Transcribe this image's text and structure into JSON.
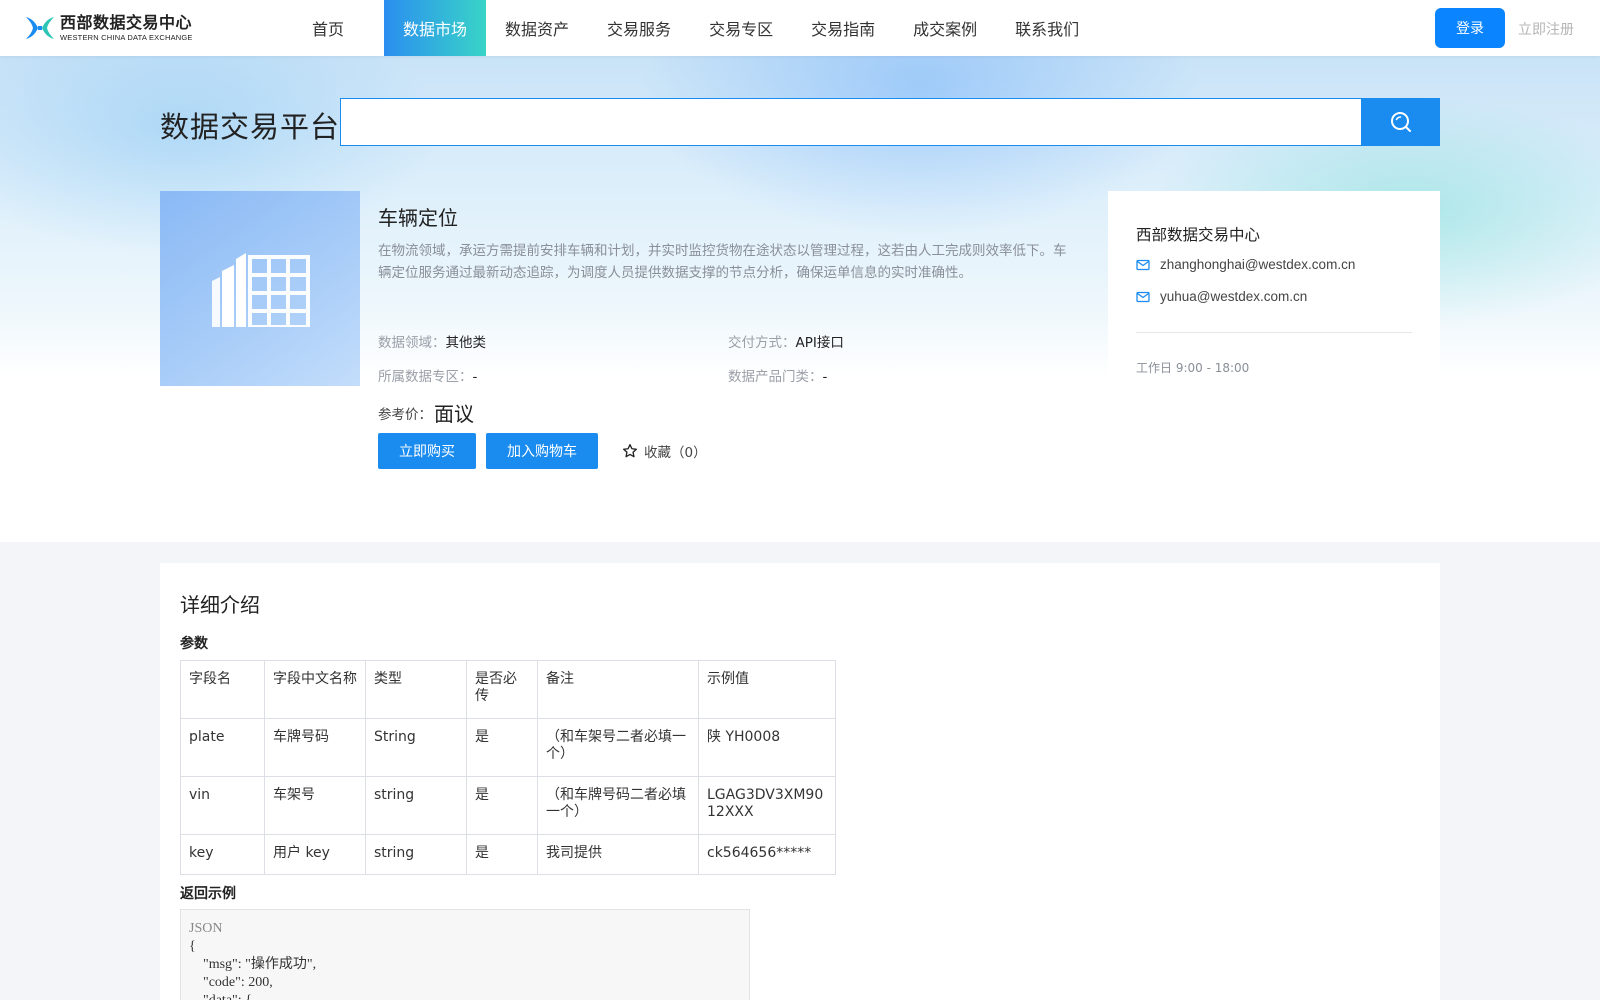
{
  "header": {
    "logo_cn": "西部数据交易中心",
    "logo_en": "WESTERN CHINA DATA EXCHANGE",
    "nav": [
      {
        "label": "首页",
        "active": false
      },
      {
        "label": "数据市场",
        "active": true
      },
      {
        "label": "数据资产",
        "active": false
      },
      {
        "label": "交易服务",
        "active": false
      },
      {
        "label": "交易专区",
        "active": false
      },
      {
        "label": "交易指南",
        "active": false
      },
      {
        "label": "成交案例",
        "active": false
      },
      {
        "label": "联系我们",
        "active": false
      }
    ],
    "login_label": "登录",
    "register_label": "立即注册"
  },
  "search": {
    "platform_title": "数据交易平台",
    "value": "",
    "icon": "search-icon"
  },
  "product": {
    "name": "车辆定位",
    "description": "在物流领域，承运方需提前安排车辆和计划，并实时监控货物在途状态以管理过程，这若由人工完成则效率低下。车辆定位服务通过最新动态追踪，为调度人员提供数据支撑的节点分析，确保运单信息的实时准确性。",
    "meta": {
      "domain_label": "数据领域：",
      "domain_value": "其他类",
      "delivery_label": "交付方式：",
      "delivery_value": "API接口",
      "zone_label": "所属数据专区：",
      "zone_value": "-",
      "category_label": "数据产品门类：",
      "category_value": "-"
    },
    "price_label": "参考价：",
    "price_value": "面议",
    "buy_label": "立即购买",
    "cart_label": "加入购物车",
    "favorite_label": "收藏（0）",
    "image_icon": "building-icon"
  },
  "contact": {
    "title": "西部数据交易中心",
    "emails": [
      "zhanghonghai@westdex.com.cn",
      "yuhua@westdex.com.cn"
    ],
    "hours": "工作日 9:00 - 18:00"
  },
  "detail": {
    "title": "详细介绍",
    "params_title": "参数",
    "columns": [
      "字段名",
      "字段中文名称",
      "类型",
      "是否必传",
      "备注",
      "示例值"
    ],
    "rows": [
      [
        "plate",
        "车牌号码",
        "String",
        "是",
        "（和车架号二者必填一个）",
        "陕 YH0008"
      ],
      [
        "vin",
        "车架号",
        "string",
        "是",
        "（和车牌号码二者必填一个）",
        "LGAG3DV3XM9012XXX"
      ],
      [
        "key",
        "用户 key",
        "string",
        "是",
        "我司提供",
        "ck564656*****"
      ]
    ],
    "response_title": "返回示例",
    "json_label": "JSON",
    "json_lines": [
      "{",
      "    \"msg\": \"操作成功\",",
      "    \"code\": 200,",
      "    \"data\": {"
    ]
  },
  "colors": {
    "primary": "#1a8cf0",
    "nav_active_start": "#2b8ef0",
    "nav_active_end": "#39d4c7"
  }
}
